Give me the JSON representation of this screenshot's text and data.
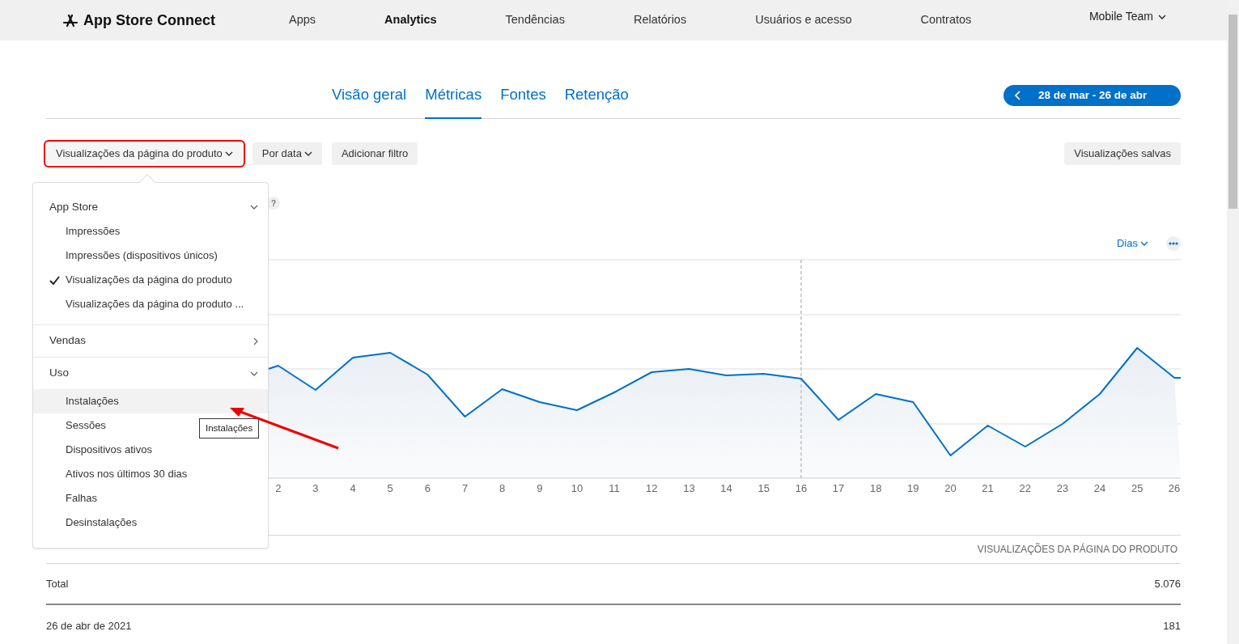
{
  "app": {
    "logo_text": "App Store Connect"
  },
  "nav": [
    {
      "label": "Apps",
      "selected": false
    },
    {
      "label": "Analytics",
      "selected": true
    },
    {
      "label": "Tendências",
      "selected": false
    },
    {
      "label": "Relatórios",
      "selected": false
    },
    {
      "label": "Usuários e acesso",
      "selected": false
    },
    {
      "label": "Contratos",
      "selected": false
    }
  ],
  "account": {
    "label": "Mobile Team"
  },
  "tabs": [
    {
      "label": "Visão geral",
      "selected": false
    },
    {
      "label": "Métricas",
      "selected": true
    },
    {
      "label": "Fontes",
      "selected": false
    },
    {
      "label": "Retenção",
      "selected": false
    }
  ],
  "date_range": {
    "label": "28 de mar - 26 de abr"
  },
  "filters": [
    {
      "label": "Visualizações da página do produto",
      "kind": "dropdown",
      "highlighted": true
    },
    {
      "label": "Por data",
      "kind": "dropdown",
      "highlighted": false
    },
    {
      "label": "Adicionar filtro",
      "kind": "button",
      "highlighted": false
    }
  ],
  "saved_views": {
    "label": "Visualizações salvas"
  },
  "metric_help": "?",
  "chart": {
    "interval": "Dias",
    "x_labels": [
      "2",
      "3",
      "4",
      "5",
      "6",
      "7",
      "8",
      "9",
      "10",
      "11",
      "12",
      "13",
      "14",
      "15",
      "16",
      "17",
      "18",
      "19",
      "20",
      "21",
      "22",
      "23",
      "24",
      "25",
      "26"
    ]
  },
  "dropdown": {
    "groups": [
      {
        "label": "App Store",
        "expanded": true,
        "items": [
          {
            "label": "Impressões",
            "selected": false,
            "hovered": false
          },
          {
            "label": "Impressões (dispositivos únicos)",
            "selected": false,
            "hovered": false
          },
          {
            "label": "Visualizações da página do produto",
            "selected": true,
            "hovered": false
          },
          {
            "label": "Visualizações da página do produto ...",
            "selected": false,
            "hovered": false
          }
        ]
      },
      {
        "label": "Vendas",
        "expanded": false
      },
      {
        "label": "Uso",
        "expanded": true,
        "items": [
          {
            "label": "Instalações",
            "selected": false,
            "hovered": true
          },
          {
            "label": "Sessões",
            "selected": false,
            "hovered": false
          },
          {
            "label": "Dispositivos ativos",
            "selected": false,
            "hovered": false
          },
          {
            "label": "Ativos nos últimos 30 dias",
            "selected": false,
            "hovered": false
          },
          {
            "label": "Falhas",
            "selected": false,
            "hovered": false
          },
          {
            "label": "Desinstalações",
            "selected": false,
            "hovered": false
          }
        ]
      }
    ]
  },
  "tooltip": {
    "text": "Instalações"
  },
  "table": {
    "columns": [
      "",
      "VISUALIZAÇÕES DA PÁGINA DO PRODUTO"
    ],
    "rows": [
      {
        "kind": "total",
        "cells": [
          "Total",
          "5.076"
        ]
      },
      {
        "kind": "day",
        "cells": [
          "26 de abr de 2021",
          "181"
        ]
      }
    ]
  }
}
